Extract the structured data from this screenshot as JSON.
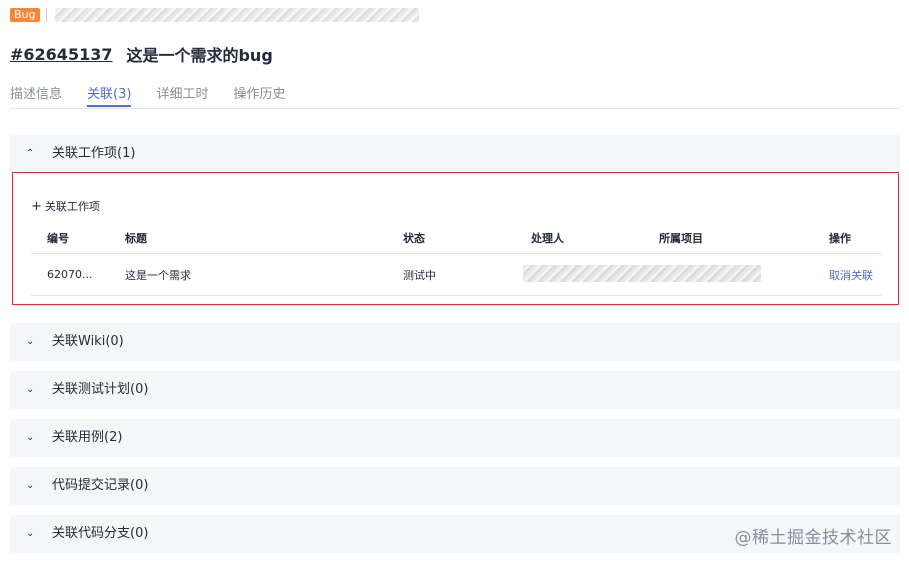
{
  "header": {
    "type_badge": "Bug",
    "issue_id": "#62645137",
    "issue_title": "这是一个需求的bug"
  },
  "tabs": [
    {
      "label": "描述信息",
      "active": false
    },
    {
      "label": "关联(3)",
      "active": true
    },
    {
      "label": "详细工时",
      "active": false
    },
    {
      "label": "操作历史",
      "active": false
    }
  ],
  "sections": {
    "work_items": {
      "title": "关联工作项(1)",
      "expanded": true,
      "arrow": "⌃"
    },
    "wiki": {
      "title": "关联Wiki(0)",
      "expanded": false,
      "arrow": "⌄"
    },
    "test_plan": {
      "title": "关联测试计划(0)",
      "expanded": false,
      "arrow": "⌄"
    },
    "test_cases": {
      "title": "关联用例(2)",
      "expanded": false,
      "arrow": "⌄"
    },
    "commits": {
      "title": "代码提交记录(0)",
      "expanded": false,
      "arrow": "⌄"
    },
    "branches": {
      "title": "关联代码分支(0)",
      "expanded": false,
      "arrow": "⌄"
    }
  },
  "work_items_panel": {
    "add_label": "关联工作项",
    "columns": [
      "编号",
      "标题",
      "状态",
      "处理人",
      "所属项目",
      "操作"
    ],
    "rows": [
      {
        "id": "62070...",
        "title": "这是一个需求",
        "status": "测试中",
        "action": "取消关联"
      }
    ]
  },
  "watermark": "@稀土掘金技术社区",
  "colors": {
    "badge": "#f0883a",
    "accent": "#526ecc",
    "panel_border": "#d42f2f",
    "section_bg": "#f5f6f8"
  }
}
